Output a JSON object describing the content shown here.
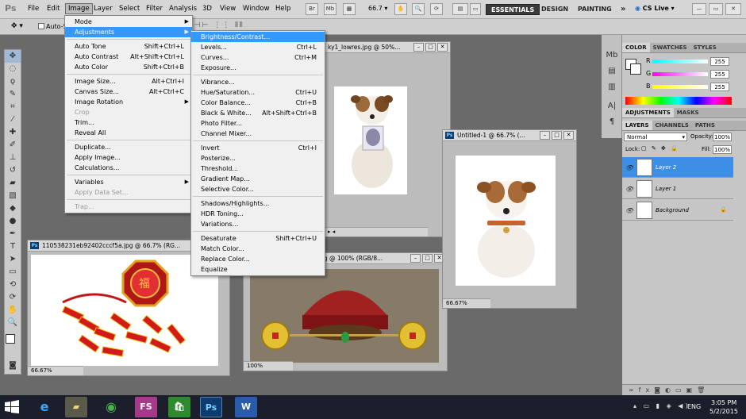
{
  "app": {
    "logo": "Ps"
  },
  "menubar": {
    "items": [
      "File",
      "Edit",
      "Image",
      "Layer",
      "Select",
      "Filter",
      "Analysis",
      "3D",
      "View",
      "Window",
      "Help"
    ],
    "zoom": "66.7",
    "workspaces": [
      "ESSENTIALS",
      "DESIGN",
      "PAINTING"
    ],
    "more": "»",
    "cslive": "CS Live"
  },
  "optbar": {
    "auto_select": "Auto-Se"
  },
  "image_menu": {
    "items": [
      {
        "label": "Mode",
        "shortcut": "",
        "arrow": true
      },
      {
        "label": "Adjustments",
        "shortcut": "",
        "arrow": true,
        "highlight": true
      },
      {
        "sep": true
      },
      {
        "label": "Auto Tone",
        "shortcut": "Shift+Ctrl+L"
      },
      {
        "label": "Auto Contrast",
        "shortcut": "Alt+Shift+Ctrl+L"
      },
      {
        "label": "Auto Color",
        "shortcut": "Shift+Ctrl+B"
      },
      {
        "sep": true
      },
      {
        "label": "Image Size...",
        "shortcut": "Alt+Ctrl+I"
      },
      {
        "label": "Canvas Size...",
        "shortcut": "Alt+Ctrl+C"
      },
      {
        "label": "Image Rotation",
        "shortcut": "",
        "arrow": true
      },
      {
        "label": "Crop",
        "shortcut": "",
        "disabled": true
      },
      {
        "label": "Trim...",
        "shortcut": ""
      },
      {
        "label": "Reveal All",
        "shortcut": ""
      },
      {
        "sep": true
      },
      {
        "label": "Duplicate...",
        "shortcut": ""
      },
      {
        "label": "Apply Image...",
        "shortcut": ""
      },
      {
        "label": "Calculations...",
        "shortcut": ""
      },
      {
        "sep": true
      },
      {
        "label": "Variables",
        "shortcut": "",
        "arrow": true
      },
      {
        "label": "Apply Data Set...",
        "shortcut": "",
        "disabled": true
      },
      {
        "sep": true
      },
      {
        "label": "Trap...",
        "shortcut": "",
        "disabled": true
      }
    ]
  },
  "adjust_menu": {
    "items": [
      {
        "label": "Brightness/Contrast...",
        "shortcut": "",
        "highlight": true
      },
      {
        "label": "Levels...",
        "shortcut": "Ctrl+L"
      },
      {
        "label": "Curves...",
        "shortcut": "Ctrl+M"
      },
      {
        "label": "Exposure...",
        "shortcut": ""
      },
      {
        "sep": true
      },
      {
        "label": "Vibrance...",
        "shortcut": ""
      },
      {
        "label": "Hue/Saturation...",
        "shortcut": "Ctrl+U"
      },
      {
        "label": "Color Balance...",
        "shortcut": "Ctrl+B"
      },
      {
        "label": "Black & White...",
        "shortcut": "Alt+Shift+Ctrl+B"
      },
      {
        "label": "Photo Filter...",
        "shortcut": ""
      },
      {
        "label": "Channel Mixer...",
        "shortcut": ""
      },
      {
        "sep": true
      },
      {
        "label": "Invert",
        "shortcut": "Ctrl+I"
      },
      {
        "label": "Posterize...",
        "shortcut": ""
      },
      {
        "label": "Threshold...",
        "shortcut": ""
      },
      {
        "label": "Gradient Map...",
        "shortcut": ""
      },
      {
        "label": "Selective Color...",
        "shortcut": ""
      },
      {
        "sep": true
      },
      {
        "label": "Shadows/Highlights...",
        "shortcut": ""
      },
      {
        "label": "HDR Toning...",
        "shortcut": ""
      },
      {
        "label": "Variations...",
        "shortcut": ""
      },
      {
        "sep": true
      },
      {
        "label": "Desaturate",
        "shortcut": "Shift+Ctrl+U"
      },
      {
        "label": "Match Color...",
        "shortcut": ""
      },
      {
        "label": "Replace Color...",
        "shortcut": ""
      },
      {
        "label": "Equalize",
        "shortcut": ""
      }
    ]
  },
  "docs": {
    "dog_top": {
      "title": "ky1_lowres.jpg @ 50%..."
    },
    "untitled": {
      "title": "Untitled-1 @ 66.7% (...",
      "zoom": "66.67%"
    },
    "firecracker": {
      "title": "110538231eb92402cccf5a.jpg @ 66.7% (RG...",
      "zoom": "66.67%"
    },
    "hat": {
      "title": "jpg @ 100% (RGB/8...",
      "zoom": "100%"
    }
  },
  "color_panel": {
    "tabs": [
      "COLOR",
      "SWATCHES",
      "STYLES"
    ],
    "channels": [
      {
        "name": "R",
        "value": "255"
      },
      {
        "name": "G",
        "value": "255"
      },
      {
        "name": "B",
        "value": "255"
      }
    ]
  },
  "adj_panel": {
    "tabs": [
      "ADJUSTMENTS",
      "MASKS"
    ]
  },
  "layers_panel": {
    "tabs": [
      "LAYERS",
      "CHANNELS",
      "PATHS"
    ],
    "blend": "Normal",
    "opacity_label": "Opacity:",
    "opacity": "100%",
    "lock_label": "Lock:",
    "fill_label": "Fill:",
    "fill": "100%",
    "layers": [
      {
        "name": "Layer 2",
        "selected": true
      },
      {
        "name": "Layer 1",
        "selected": false
      },
      {
        "name": "Background",
        "selected": false
      }
    ]
  },
  "taskbar": {
    "apps": [
      "IE",
      "Explorer",
      "Chrome",
      "FS",
      "Store",
      "Ps",
      "W"
    ],
    "lang": "ENG",
    "time": "3:05 PM",
    "date": "5/2/2015"
  },
  "colors": {
    "highlight": "#3399ff",
    "layer_selected": "#3d8ee6"
  }
}
